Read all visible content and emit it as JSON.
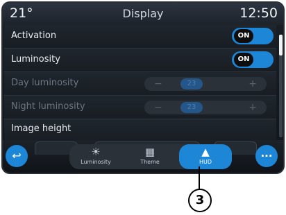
{
  "status": {
    "temperature": "21°",
    "title": "Display",
    "time": "12:50"
  },
  "settings": {
    "activation": {
      "label": "Activation",
      "toggle": "ON"
    },
    "luminosity": {
      "label": "Luminosity",
      "toggle": "ON"
    },
    "day_luminosity": {
      "label": "Day luminosity",
      "minus": "−",
      "value": "23",
      "plus": "+"
    },
    "night_luminosity": {
      "label": "Night luminosity",
      "minus": "−",
      "value": "23",
      "plus": "+"
    },
    "image_height": {
      "label": "Image height"
    }
  },
  "tabs": [
    {
      "label": "Luminosity",
      "icon": "sun-icon",
      "glyph": "☀"
    },
    {
      "label": "Theme",
      "icon": "theme-icon",
      "glyph": "▦"
    },
    {
      "label": "HUD",
      "icon": "hud-icon",
      "glyph": "▲"
    }
  ],
  "buttons": {
    "back_glyph": "↩",
    "more_glyph": "···"
  },
  "callout": "3",
  "colors": {
    "accent": "#1e86d6",
    "background": "#151a20",
    "text": "#e9edf2"
  }
}
